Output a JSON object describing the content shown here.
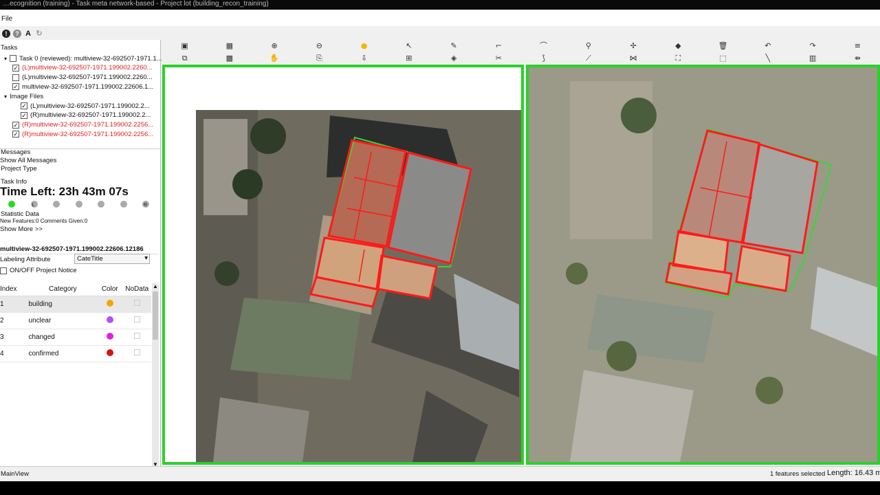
{
  "window_title": "…ecognition (training) - Task meta network-based - Project lot (building_recon_training)",
  "menu": {
    "file": "File"
  },
  "top_icons": [
    {
      "name": "info-icon",
      "glyph": "!"
    },
    {
      "name": "help-icon",
      "glyph": "?"
    },
    {
      "name": "font-icon",
      "glyph": "A"
    },
    {
      "name": "refresh-icon",
      "glyph": "↻"
    }
  ],
  "tasks": {
    "header": "Tasks",
    "rows": [
      {
        "text": "Task 0 (reviewed): multiview-32-692507-1971.1...",
        "checked": false,
        "red": false,
        "indent": 1,
        "arrow": "▾"
      },
      {
        "text": "(L)multiview-32-692507-1971.199002.2260...",
        "checked": true,
        "red": true,
        "indent": 2
      },
      {
        "text": "(L)multiview-32-692507-1971.199002.2260...",
        "checked": false,
        "red": false,
        "indent": 2
      },
      {
        "text": "multiview-32-692507-1971.199002.22606.1...",
        "checked": true,
        "red": false,
        "indent": 2
      },
      {
        "text": "Image Files",
        "checked": null,
        "red": false,
        "indent": 1,
        "arrow": "▾"
      },
      {
        "text": "(L)multiview-32-692507-1971.199002.2...",
        "checked": true,
        "red": false,
        "indent": 3
      },
      {
        "text": "(R)multiview-32-692507-1971.199002.2...",
        "checked": true,
        "red": false,
        "indent": 3
      },
      {
        "text": "(R)multiview-32-692507-1971.199002.2256...",
        "checked": true,
        "red": true,
        "indent": 2
      },
      {
        "text": "(R)multiview-32-692507-1971.199002.2256...",
        "checked": true,
        "red": true,
        "indent": 2
      }
    ]
  },
  "messages": {
    "header": "Messages",
    "show_all": "Show All Messages"
  },
  "project_type": "Project Type",
  "task_info": {
    "header": "Task Info",
    "time_left": "Time Left: 23h 43m 07s",
    "progress_labels": [
      "",
      "L",
      "",
      "",
      "",
      "",
      "R"
    ],
    "progress_active_index": 0
  },
  "statistics": {
    "header": "Statistic Data",
    "text": "New Features:0 Comments Given:0",
    "show_more": "Show More >>"
  },
  "layer": {
    "name": "multiview-32-692507-1971.199002.22606.12186",
    "attr_label": "Labeling Attribute",
    "attr_value": "CateTitle",
    "notice_label": "ON/OFF Project Notice"
  },
  "category_table": {
    "headers": [
      "Index",
      "Category",
      "Color",
      "NoData"
    ],
    "rows": [
      {
        "index": "1",
        "category": "building",
        "color": "#f0a800",
        "selected": true
      },
      {
        "index": "2",
        "category": "unclear",
        "color": "#b450f0",
        "selected": false
      },
      {
        "index": "3",
        "category": "changed",
        "color": "#e020e0",
        "selected": false
      },
      {
        "index": "4",
        "category": "confirmed",
        "color": "#dd1111",
        "selected": false
      }
    ]
  },
  "toolbar_icons": {
    "row1": [
      {
        "name": "save-icon",
        "glyph": "▣"
      },
      {
        "name": "layer-icon",
        "glyph": "▦"
      },
      {
        "name": "zoom-in-icon",
        "glyph": "⊕"
      },
      {
        "name": "zoom-out-icon",
        "glyph": "⊖"
      },
      {
        "name": "point-icon",
        "glyph": "●"
      },
      {
        "name": "select-icon",
        "glyph": "↖"
      },
      {
        "name": "pen-icon",
        "glyph": "✎"
      },
      {
        "name": "polyline-icon",
        "glyph": "⌐"
      },
      {
        "name": "curve-icon",
        "glyph": "⌒"
      },
      {
        "name": "pin-icon",
        "glyph": "⚲"
      },
      {
        "name": "vertex-icon",
        "glyph": "✢"
      },
      {
        "name": "erase-icon",
        "glyph": "◆"
      },
      {
        "name": "delete-icon",
        "glyph": "🗑"
      },
      {
        "name": "undo-icon",
        "glyph": "↶"
      },
      {
        "name": "redo-icon",
        "glyph": "↷"
      },
      {
        "name": "menu-icon",
        "glyph": "≡"
      }
    ],
    "row2": [
      {
        "name": "split-view-icon",
        "glyph": "⧉"
      },
      {
        "name": "grid-icon",
        "glyph": "▩"
      },
      {
        "name": "pan-icon",
        "glyph": "✋"
      },
      {
        "name": "copy-icon",
        "glyph": "⎘"
      },
      {
        "name": "export-icon",
        "glyph": "⇩"
      },
      {
        "name": "merge-icon",
        "glyph": "⊞"
      },
      {
        "name": "tag-icon",
        "glyph": "◈"
      },
      {
        "name": "cut-icon",
        "glyph": "✂"
      },
      {
        "name": "reshape-icon",
        "glyph": "⟆"
      },
      {
        "name": "line-edit-icon",
        "glyph": "⟋"
      },
      {
        "name": "node-icon",
        "glyph": "⋈"
      },
      {
        "name": "frame-icon",
        "glyph": "⛶"
      },
      {
        "name": "box-icon",
        "glyph": "⬚"
      },
      {
        "name": "measure-icon",
        "glyph": "╲"
      },
      {
        "name": "bars-icon",
        "glyph": "▥"
      },
      {
        "name": "arrange-icon",
        "glyph": "⇻"
      }
    ]
  },
  "status": {
    "left": "MainView",
    "selected": "1 features selected",
    "length": "Length: 16.43 m"
  },
  "colors": {
    "view_border": "#2bd12b",
    "polygon_red": "#ff1a1a",
    "polygon_green": "#3ad43a"
  }
}
